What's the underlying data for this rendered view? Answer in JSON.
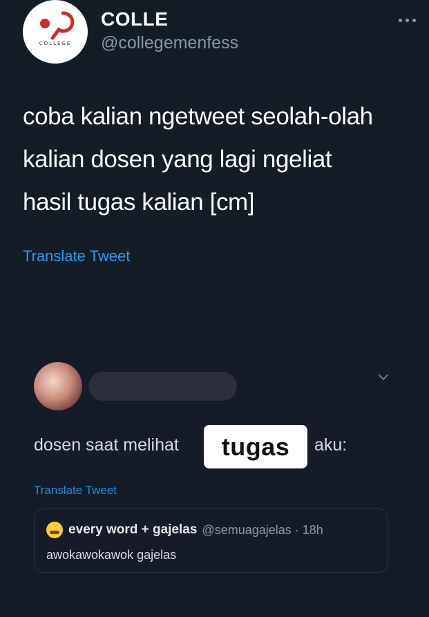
{
  "account": {
    "display_name": "COLLE",
    "handle": "@collegemenfess",
    "avatar_logo_text": "COLLEGE"
  },
  "tweet": {
    "text": "coba kalian ngetweet seolah-olah\nkalian dosen yang lagi ngeliat\nhasil tugas kalian [cm]",
    "translate_label": "Translate Tweet"
  },
  "media": {
    "inner_text_before": "dosen saat melihat",
    "sticker_text": "tugas",
    "inner_text_after": "aku:",
    "translate_label": "Translate Tweet",
    "quote": {
      "name": "every word + gajelas",
      "handle_time": "@semuagajelas · 18h",
      "body": "awokawokawok gajelas"
    }
  },
  "icons": {
    "more": "more-horizontal-icon",
    "chevron": "chevron-down-icon",
    "emoji": "grimacing-emoji-icon"
  },
  "colors": {
    "background": "#141d26",
    "link": "#1da1f2",
    "muted": "#8899a6",
    "logo_red": "#d12b2b"
  }
}
